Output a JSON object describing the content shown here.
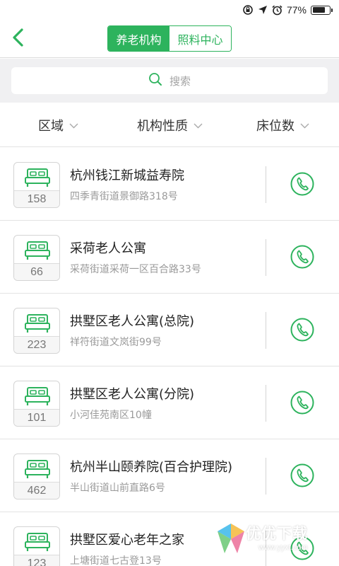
{
  "status_bar": {
    "battery_percent": "77%",
    "battery_level": 0.77
  },
  "nav": {
    "tabs": [
      {
        "label": "养老机构",
        "active": true
      },
      {
        "label": "照料中心",
        "active": false
      }
    ]
  },
  "search": {
    "placeholder": "搜索"
  },
  "filters": [
    {
      "label": "区域"
    },
    {
      "label": "机构性质"
    },
    {
      "label": "床位数"
    }
  ],
  "institutions": [
    {
      "name": "杭州钱江新城益寿院",
      "address": "四季青街道景御路318号",
      "beds": "158"
    },
    {
      "name": "采荷老人公寓",
      "address": "采荷街道采荷一区百合路33号",
      "beds": "66"
    },
    {
      "name": "拱墅区老人公寓(总院)",
      "address": "祥符街道文岚街99号",
      "beds": "223"
    },
    {
      "name": "拱墅区老人公寓(分院)",
      "address": "小河佳苑南区10幢",
      "beds": "101"
    },
    {
      "name": "杭州半山颐养院(百合护理院)",
      "address": "半山街道山前直路6号",
      "beds": "462"
    },
    {
      "name": "拱墅区爱心老年之家",
      "address": "上塘街道七古登13号",
      "beds": "123"
    }
  ],
  "watermark": {
    "text": "优优下载",
    "url": "www.yyxt.com"
  },
  "colors": {
    "accent": "#2db35d",
    "page_bg": "#ffffff",
    "search_bg": "#f0f0f2"
  },
  "icons": [
    "back-arrow",
    "search",
    "chevron-down",
    "bed",
    "phone",
    "rotation-lock",
    "location-arrow",
    "alarm",
    "battery"
  ]
}
